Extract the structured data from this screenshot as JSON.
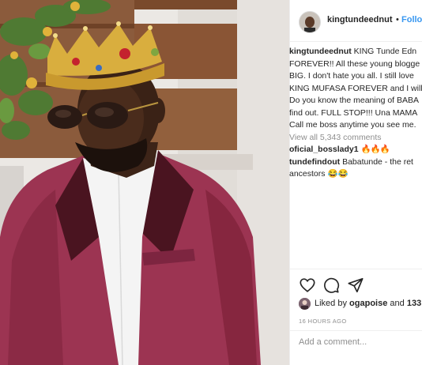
{
  "header": {
    "username": "kingtundeednut",
    "separator": "•",
    "follow_label": "Follo"
  },
  "caption": {
    "username": "kingtundeednut",
    "lines": [
      "KING Tunde Edn",
      "FOREVER!! All these young blogge",
      "BIG. I don't hate you all. I still love",
      "KING MUFASA FOREVER and I will",
      "Do you know the meaning of BABA",
      "find out. FULL STOP!!! Una MAMA",
      "Call me boss anytime you see me."
    ]
  },
  "view_all_comments": "View all 5,343 comments",
  "comments": [
    {
      "username": "oficial_bosslady1",
      "text": "🔥🔥🔥"
    },
    {
      "username": "tundefindout",
      "text": "Babatunde - the ret",
      "line2": "ancestors",
      "emoji": "😂😂"
    }
  ],
  "actions": {
    "like_icon": "heart-icon",
    "comment_icon": "comment-icon",
    "share_icon": "share-icon"
  },
  "likes": {
    "prefix": "Liked by",
    "user": "ogapoise",
    "conjunction": "and",
    "count": "133"
  },
  "timestamp": "16 HOURS AGO",
  "add_comment": {
    "placeholder": "Add a comment..."
  },
  "colors": {
    "link_blue": "#3897f0",
    "text": "#262626",
    "muted": "#8e8e8e",
    "suit": "#9c3452"
  }
}
